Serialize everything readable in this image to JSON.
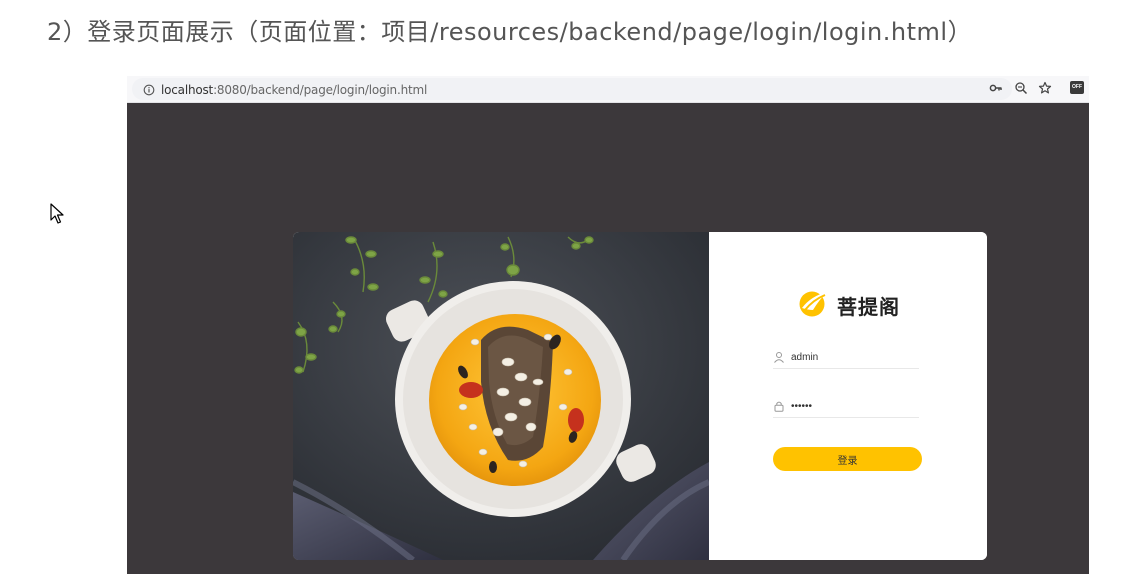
{
  "heading": "2）登录页面展示（页面位置：项目/resources/backend/page/login/login.html）",
  "browser": {
    "url_host": "localhost",
    "url_path": ":8080/backend/page/login/login.html",
    "icons": [
      "info-icon",
      "key-icon",
      "zoom-icon",
      "star-icon",
      "extension-icon"
    ],
    "extension_badge": "OFF"
  },
  "login": {
    "brand_name": "菩提阁",
    "username_value": "admin",
    "password_value": "123456",
    "submit_label": "登录",
    "icons": [
      "user-icon",
      "lock-icon",
      "brand-logo-icon"
    ]
  },
  "colors": {
    "accent": "#ffc200",
    "page_background": "#3c383b",
    "heading_text": "#555555"
  }
}
